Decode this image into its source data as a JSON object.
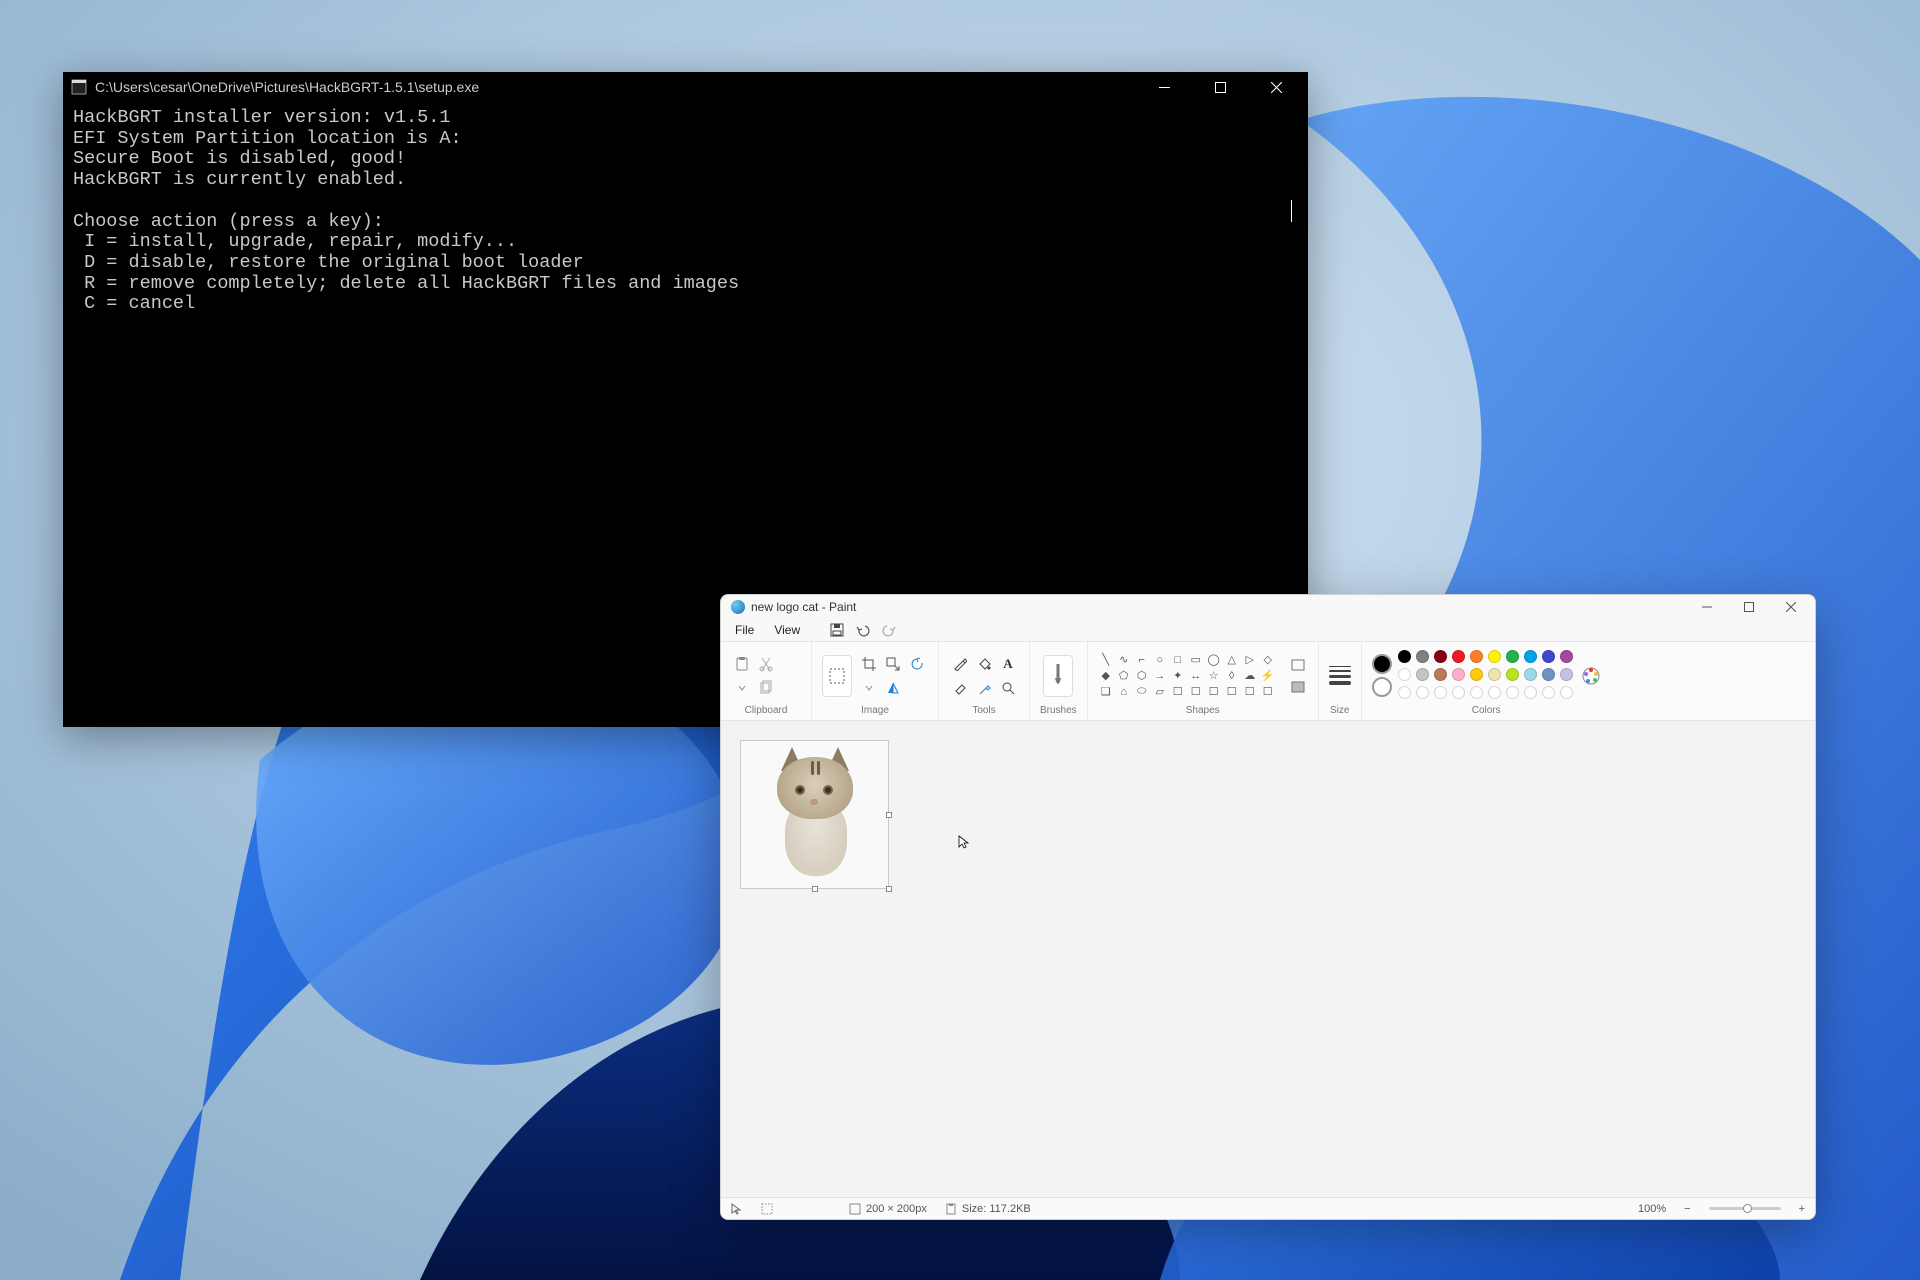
{
  "terminal": {
    "title": "C:\\Users\\cesar\\OneDrive\\Pictures\\HackBGRT-1.5.1\\setup.exe",
    "lines": [
      "HackBGRT installer version: v1.5.1",
      "EFI System Partition location is A:",
      "Secure Boot is disabled, good!",
      "HackBGRT is currently enabled.",
      "",
      "Choose action (press a key):",
      " I = install, upgrade, repair, modify...",
      " D = disable, restore the original boot loader",
      " R = remove completely; delete all HackBGRT files and images",
      " C = cancel"
    ]
  },
  "paint": {
    "title": "new logo cat - Paint",
    "menus": {
      "file": "File",
      "view": "View"
    },
    "ribbon_groups": {
      "clipboard": "Clipboard",
      "image": "Image",
      "tools": "Tools",
      "brushes": "Brushes",
      "shapes": "Shapes",
      "size": "Size",
      "colors": "Colors"
    },
    "colors_row1": [
      "#000000",
      "#7f7f7f",
      "#880015",
      "#ed1c24",
      "#ff7f27",
      "#fff200",
      "#22b14c",
      "#00a2e8",
      "#3f48cc",
      "#a349a4"
    ],
    "colors_row2": [
      "#ffffff",
      "#c3c3c3",
      "#b97a57",
      "#ffaec9",
      "#ffc90e",
      "#efe4b0",
      "#b5e61d",
      "#99d9ea",
      "#7092be",
      "#c8bfe7"
    ],
    "status": {
      "dimensions": "200 × 200px",
      "size": "Size: 117.2KB",
      "zoom": "100%"
    }
  }
}
